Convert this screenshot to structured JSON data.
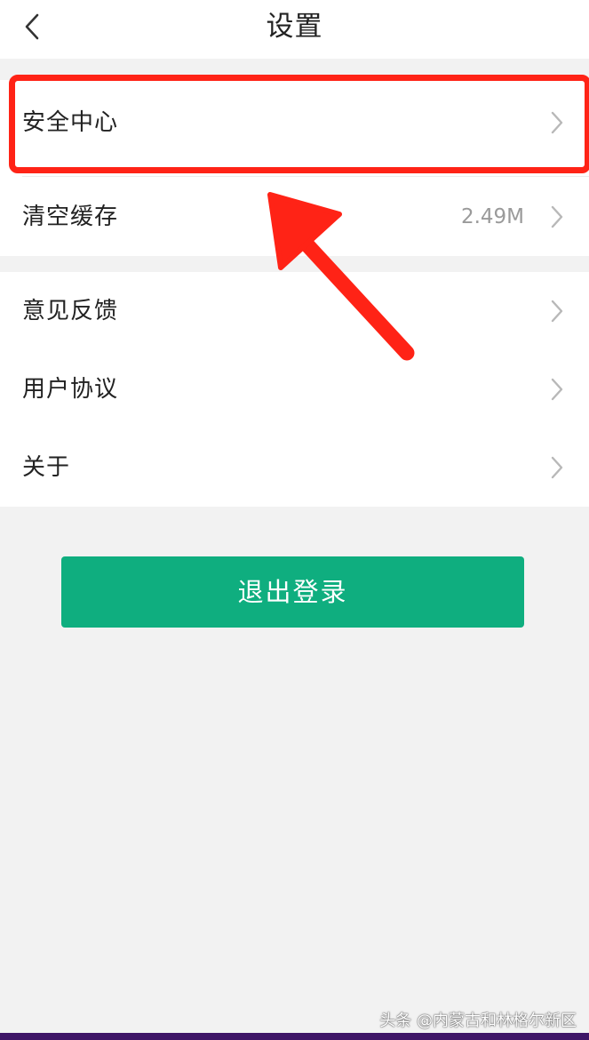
{
  "header": {
    "title": "设置",
    "back_icon": "chevron-left-icon"
  },
  "settings": {
    "security_center": {
      "label": "安全中心"
    },
    "clear_cache": {
      "label": "清空缓存",
      "value": "2.49M"
    },
    "feedback": {
      "label": "意见反馈"
    },
    "user_agreement": {
      "label": "用户协议"
    },
    "about": {
      "label": "关于"
    }
  },
  "logout": {
    "label": "退出登录"
  },
  "annotation": {
    "highlight_color": "#ff2316",
    "arrow_color": "#ff2316"
  },
  "watermark": {
    "text": "头条 @内蒙古和林格尔新区"
  },
  "colors": {
    "accent": "#0fae7f",
    "background": "#f2f2f2",
    "value_text": "#9a9a9a",
    "chevron": "#b8b8b8"
  }
}
